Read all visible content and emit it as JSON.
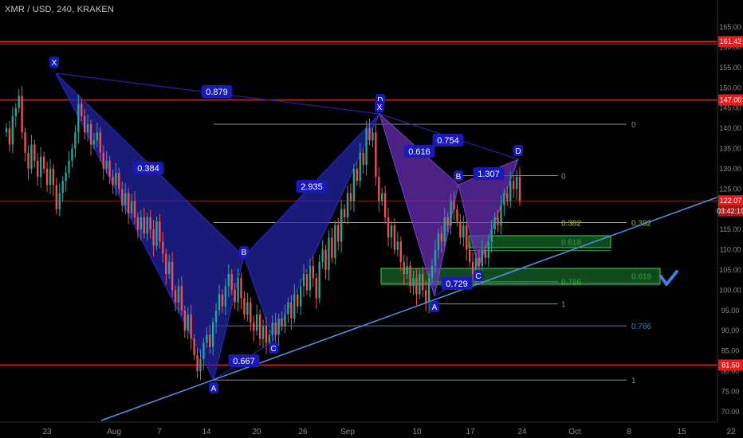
{
  "header": {
    "symbol": "XMR / USD, 240, KRAKEN"
  },
  "chart_data": {
    "type": "candlestick",
    "ylim": [
      68,
      166
    ],
    "y_ticks": [
      70,
      75,
      80,
      85,
      90,
      95,
      100,
      105,
      110,
      115,
      120,
      125,
      130,
      135,
      140,
      145,
      150,
      155,
      160,
      165
    ],
    "x_ticks": [
      "23",
      "Aug",
      "7",
      "14",
      "20",
      "26",
      "Sep",
      "10",
      "17",
      "24",
      "Oct",
      "8",
      "15",
      "22"
    ],
    "grid": false,
    "price_labels": [
      {
        "text": "161.42",
        "value": 161.42,
        "color": "#e61b1b"
      },
      {
        "text": "147.00",
        "value": 147.0,
        "color": "#e61b1b"
      },
      {
        "text": "122.07",
        "value": 122.07,
        "color": "#e61b1b"
      },
      {
        "text": "03:42:19",
        "value": 119.6,
        "color": "#a51818"
      },
      {
        "text": "81.50",
        "value": 81.5,
        "color": "#e61b1b"
      }
    ],
    "horizontal_lines": [
      {
        "name": "resistance-161",
        "value": 161.42,
        "color": "#e61b1b"
      },
      {
        "name": "resistance-147",
        "value": 147.0,
        "color": "#e61b1b"
      },
      {
        "name": "support-81",
        "value": 81.5,
        "color": "#e61b1b"
      }
    ],
    "candles_close": [
      140,
      136,
      143,
      145,
      148,
      139,
      134,
      130,
      136,
      132,
      128,
      133,
      130,
      126,
      130,
      126,
      120,
      124,
      127,
      129,
      132,
      135,
      139,
      146,
      143,
      139,
      141,
      136,
      137,
      139,
      134,
      130,
      132,
      128,
      126,
      129,
      125,
      121,
      124,
      119,
      122,
      118,
      115,
      118,
      114,
      118,
      115,
      111,
      117,
      112,
      109,
      104,
      107,
      100,
      97,
      101,
      95,
      90,
      94,
      88,
      84,
      80,
      83,
      87,
      89,
      86,
      92,
      95,
      99,
      96,
      101,
      104,
      100,
      97,
      103,
      98,
      94,
      97,
      92,
      90,
      94,
      88,
      91,
      87,
      89,
      92,
      89,
      93,
      91,
      94,
      97,
      93,
      99,
      96,
      101,
      104,
      100,
      106,
      103,
      98,
      107,
      110,
      105,
      113,
      108,
      116,
      112,
      120,
      118,
      124,
      122,
      130,
      127,
      134,
      131,
      140,
      137,
      139,
      128,
      122,
      124,
      118,
      113,
      116,
      110,
      112,
      107,
      104,
      106,
      101,
      103,
      99,
      104,
      100,
      97,
      103,
      106,
      110,
      114,
      112,
      118,
      116,
      122,
      120,
      117,
      113,
      116,
      110,
      107,
      104,
      108,
      106,
      110,
      108,
      112,
      115,
      118,
      116,
      121,
      124,
      122,
      127,
      125,
      128,
      122
    ],
    "fib_levels": [
      {
        "label": "0",
        "value": 141
      },
      {
        "label": "0",
        "value": 128.3
      },
      {
        "label": "0.382",
        "value": 116.7
      },
      {
        "label": "0.382",
        "value": 116.7
      },
      {
        "label": "0.618",
        "value": 109.8
      },
      {
        "label": "0.786",
        "value": 102.1
      },
      {
        "label": "0.618",
        "value": 101.3
      },
      {
        "label": "1",
        "value": 96.6
      },
      {
        "label": "0.786",
        "value": 91.2
      },
      {
        "label": "1",
        "value": 77.8
      }
    ],
    "pattern_points": [
      "X",
      "A",
      "B",
      "C",
      "D",
      "D",
      "X",
      "B",
      "D",
      "A",
      "C"
    ],
    "ratios": [
      "0.879",
      "0.384",
      "2.935",
      "0.667",
      "0.616",
      "0.754",
      "1.307",
      "0.729"
    ],
    "colors": {
      "background": "#000000",
      "bullish": "#26a69a",
      "bearish": "#ef5350",
      "pattern_fill": "#2424a8",
      "pattern_fill_2": "#6a30b8",
      "trendline": "#4f8fe0",
      "fib_gray": "#8a8a8a",
      "fib_olive": "#a8b832",
      "fib_green": "#26a641",
      "fib_blue": "#4a7fa8",
      "check": "#3f7fe0"
    }
  }
}
